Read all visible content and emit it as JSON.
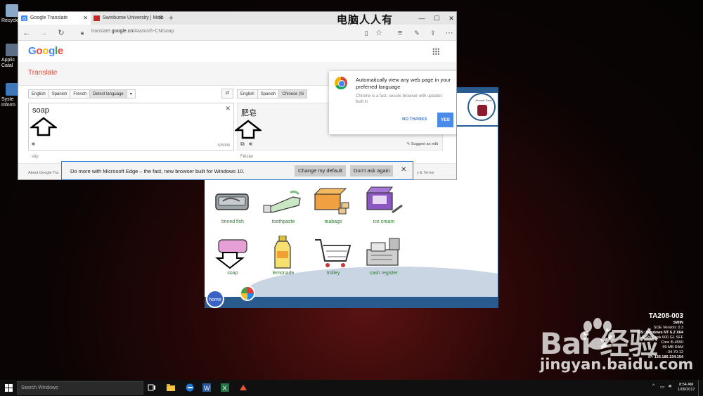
{
  "desktop": {
    "icons": [
      {
        "label": "Recycle"
      },
      {
        "label": "Applic Catal"
      },
      {
        "label": "Syste Inform"
      }
    ],
    "watermark_top": "电脑人人有",
    "baidu_brand": "Bai  经验",
    "baidu_url": "jingyan.baidu.com"
  },
  "browser": {
    "tabs": [
      {
        "label": "Google Translate"
      },
      {
        "label": "Swinburne University | Melb"
      }
    ],
    "new_tab": "+",
    "address": {
      "prefix": "translate.",
      "domain": "google.cn",
      "path": "/#auto/zh-CN/soap"
    },
    "window_controls": {
      "minimize": "—",
      "maximize": "☐",
      "close": "✕"
    }
  },
  "translate": {
    "logo_letters": [
      {
        "ch": "G",
        "color": "#4285f4"
      },
      {
        "ch": "o",
        "color": "#ea4335"
      },
      {
        "ch": "o",
        "color": "#fbbc05"
      },
      {
        "ch": "g",
        "color": "#4285f4"
      },
      {
        "ch": "l",
        "color": "#34a853"
      },
      {
        "ch": "e",
        "color": "#ea4335"
      }
    ],
    "title": "Translate",
    "source_langs": [
      "English",
      "Spanish",
      "French",
      "Detect language"
    ],
    "target_langs": [
      "English",
      "Spanish",
      "Chinese (Si"
    ],
    "source_text": "soap",
    "target_text": "肥皂",
    "char_count": "5/5000",
    "source_translit": "sōp",
    "target_translit": "Féizào",
    "suggest_edit": "Suggest an edit",
    "footer_left": "About Google Tra",
    "footer_right": "y & Terms"
  },
  "chrome_promo": {
    "heading": "Automatically view any web page in your preferred language",
    "sub": "Chrome is a fast, secure browser with updates built in",
    "no_label": "NO THANKS",
    "yes_label": "YES"
  },
  "edge_bar": {
    "message": "Do more with Microsoft Edge – the fast, new browser built for Windows 10.",
    "change_default": "Change my default",
    "dont_ask": "Don't ask again"
  },
  "quiz": {
    "avatar_caption": "Around Town",
    "items": [
      {
        "label": "tinned fish"
      },
      {
        "label": "toothpaste"
      },
      {
        "label": "teabags"
      },
      {
        "label": "ice cream"
      },
      {
        "label": "soap"
      },
      {
        "label": "lemonade"
      },
      {
        "label": "trolley"
      },
      {
        "label": "cash register"
      }
    ],
    "home_label": "home"
  },
  "sysinfo": {
    "host": "TA208-003",
    "org": "SWIN",
    "lines": [
      "SOE Version: 0.3",
      "OS: Windows NT 6.2 X64",
      "HP ProDesk 600 G1 SFF",
      "Core i5-4590",
      "99 MB RAM",
      "-34-70-12",
      "IP: 136.186.134.154"
    ]
  },
  "taskbar": {
    "search_placeholder": "Search Windows",
    "time": "8:54 AM",
    "date": "1/09/2017"
  }
}
